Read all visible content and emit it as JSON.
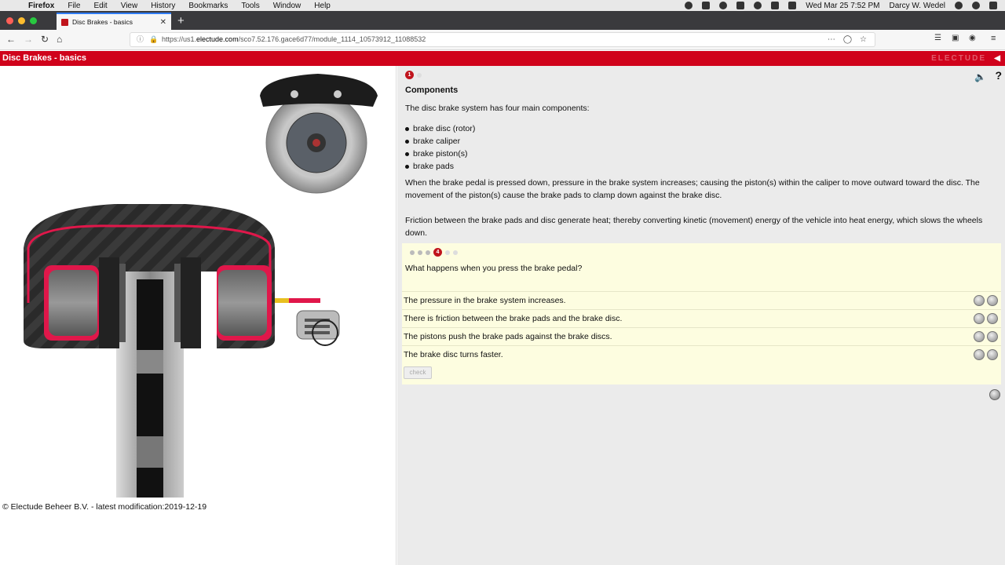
{
  "menubar": {
    "apple": "",
    "items": [
      "Firefox",
      "File",
      "Edit",
      "View",
      "History",
      "Bookmarks",
      "Tools",
      "Window",
      "Help"
    ],
    "clock": "Wed Mar 25  7:52 PM",
    "user": "Darcy W. Wedel"
  },
  "browser": {
    "tab_title": "Disc Brakes - basics",
    "tab_close": "✕",
    "new_tab": "+",
    "url_prefix": "https://us1.",
    "url_domain": "electude.com",
    "url_path": "/sco7.52.176.gace6d77/module_1114_10573912_11088532"
  },
  "header": {
    "title": "Disc Brakes - basics",
    "brand": "ELECTUDE"
  },
  "left": {
    "footer": "© Electude Beheer B.V. - latest modification:2019-12-19"
  },
  "content": {
    "page_number": "1",
    "heading": "Components",
    "intro": "The disc brake system has four main components:",
    "bullets": [
      "brake disc (rotor)",
      "brake caliper",
      "brake piston(s)",
      "brake pads"
    ],
    "para1": "When the brake pedal is pressed down, pressure in the brake system increases; causing the piston(s) within the caliper to move outward toward the disc. The movement of the piston(s) cause the brake pads to clamp down against the brake disc.",
    "para2": "Friction between the brake pads and disc generate heat; thereby converting kinetic (movement) energy of the vehicle into heat energy, which slows the wheels down."
  },
  "quiz": {
    "step_number": "4",
    "question": "What happens when you press the brake pedal?",
    "answers": [
      "The pressure in the brake system increases.",
      "There is friction between the brake pads and the brake disc.",
      "The pistons push the brake pads against the brake discs.",
      "The brake disc turns faster."
    ],
    "check_label": "check"
  },
  "colors": {
    "brand_red": "#d0021b",
    "quiz_bg": "#fdfde0",
    "content_bg": "#ebebeb"
  }
}
